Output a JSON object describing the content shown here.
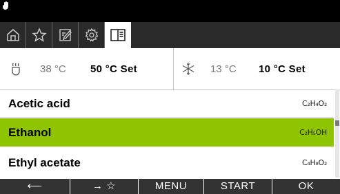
{
  "status": {
    "icon": "hand-icon"
  },
  "tabs": [
    {
      "icon": "home-icon"
    },
    {
      "icon": "star-icon"
    },
    {
      "icon": "edit-icon"
    },
    {
      "icon": "gear-icon"
    },
    {
      "icon": "book-icon",
      "active": true
    }
  ],
  "heating": {
    "icon": "heater-icon",
    "current": "38 °C",
    "set": "50 °C Set"
  },
  "cooling": {
    "icon": "snowflake-icon",
    "current": "13 °C",
    "set": "10 °C Set"
  },
  "solvents": [
    {
      "name": "Acetic acid",
      "formula": "C₂H₄O₂"
    },
    {
      "name": "Ethanol",
      "formula": "C₂H₅OH",
      "selected": true
    },
    {
      "name": "Ethyl acetate",
      "formula": "C₄H₈O₂"
    }
  ],
  "colors": {
    "selected": "#8fc400",
    "tabbar": "#2a2a2a",
    "softbar": "#333333"
  },
  "softkeys": {
    "back": "⟵",
    "to_favorites": "→ ☆",
    "menu": "MENU",
    "start": "START",
    "ok": "OK"
  }
}
